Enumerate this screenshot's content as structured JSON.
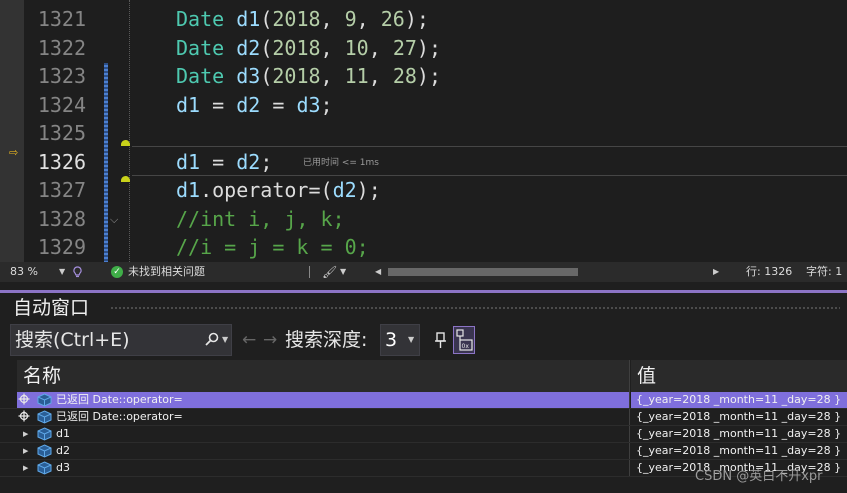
{
  "editor": {
    "lines": [
      {
        "no": "1321",
        "tokens": [
          [
            "type",
            "Date"
          ],
          [
            "punc",
            " "
          ],
          [
            "var",
            "d1"
          ],
          [
            "punc",
            "("
          ],
          [
            "num",
            "2018"
          ],
          [
            "punc",
            ", "
          ],
          [
            "num",
            "9"
          ],
          [
            "punc",
            ", "
          ],
          [
            "num",
            "26"
          ],
          [
            "punc",
            ");"
          ]
        ]
      },
      {
        "no": "1322",
        "tokens": [
          [
            "type",
            "Date"
          ],
          [
            "punc",
            " "
          ],
          [
            "var",
            "d2"
          ],
          [
            "punc",
            "("
          ],
          [
            "num",
            "2018"
          ],
          [
            "punc",
            ", "
          ],
          [
            "num",
            "10"
          ],
          [
            "punc",
            ", "
          ],
          [
            "num",
            "27"
          ],
          [
            "punc",
            ");"
          ]
        ]
      },
      {
        "no": "1323",
        "tokens": [
          [
            "type",
            "Date"
          ],
          [
            "punc",
            " "
          ],
          [
            "var",
            "d3"
          ],
          [
            "punc",
            "("
          ],
          [
            "num",
            "2018"
          ],
          [
            "punc",
            ", "
          ],
          [
            "num",
            "11"
          ],
          [
            "punc",
            ", "
          ],
          [
            "num",
            "28"
          ],
          [
            "punc",
            ");"
          ]
        ]
      },
      {
        "no": "1324",
        "tokens": [
          [
            "var",
            "d1"
          ],
          [
            "punc",
            " = "
          ],
          [
            "var",
            "d2"
          ],
          [
            "punc",
            " = "
          ],
          [
            "var",
            "d3"
          ],
          [
            "punc",
            ";"
          ]
        ]
      },
      {
        "no": "1325",
        "tokens": []
      },
      {
        "no": "1326",
        "tokens": [
          [
            "var",
            "d1"
          ],
          [
            "punc",
            " = "
          ],
          [
            "var",
            "d2"
          ],
          [
            "punc",
            ";"
          ]
        ],
        "current": true
      },
      {
        "no": "1327",
        "tokens": [
          [
            "var",
            "d1"
          ],
          [
            "punc",
            "."
          ],
          [
            "fn",
            "operator="
          ],
          [
            "punc",
            "("
          ],
          [
            "var",
            "d2"
          ],
          [
            "punc",
            ");"
          ]
        ]
      },
      {
        "no": "1328",
        "tokens": [
          [
            "cmt",
            "//int i, j, k;"
          ]
        ]
      },
      {
        "no": "1329",
        "tokens": [
          [
            "cmt",
            "//i = j = k = 0;"
          ]
        ]
      }
    ],
    "perf_tip": "已用时间 <= 1ms"
  },
  "status": {
    "zoom": "83 %",
    "issues": "未找到相关问题",
    "line": "行: 1326",
    "col": "字符: 1"
  },
  "autos": {
    "title": "自动窗口",
    "search_placeholder": "搜索(Ctrl+E)",
    "depth_label": "搜索深度:",
    "depth_value": "3",
    "col_name": "名称",
    "col_value": "值",
    "rows": [
      {
        "label": "已返回 Date::operator=",
        "value": "{_year=2018 _month=11 _day=28 }",
        "returned": true,
        "selected": true
      },
      {
        "label": "已返回 Date::operator=",
        "value": "{_year=2018 _month=11 _day=28 }",
        "returned": true,
        "selected": false
      },
      {
        "label": "d1",
        "value": "{_year=2018 _month=11 _day=28 }",
        "returned": false,
        "selected": false
      },
      {
        "label": "d2",
        "value": "{_year=2018 _month=11 _day=28 }",
        "returned": false,
        "selected": false
      },
      {
        "label": "d3",
        "value": "{_year=2018 _month=11 _day=28 }",
        "returned": false,
        "selected": false
      }
    ]
  },
  "watermark": "CSDN @英白不开xpr",
  "colors": {
    "accent": "#8c74c6",
    "selection": "#7f6fdc",
    "type": "#4ec9b0",
    "variable": "#9cdcfe",
    "number": "#b5cea8",
    "comment": "#57a64a"
  }
}
